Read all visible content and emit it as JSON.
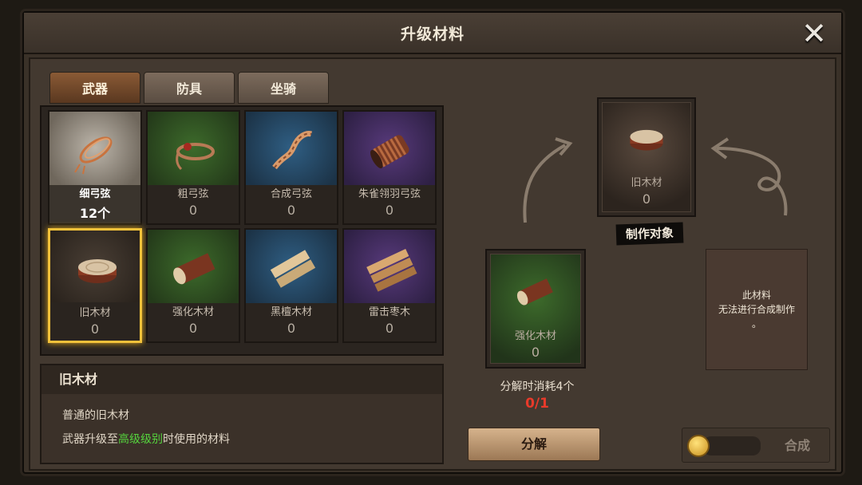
{
  "window": {
    "title": "升级材料",
    "close_icon": "close-icon"
  },
  "tabs": [
    {
      "label": "武器",
      "active": true
    },
    {
      "label": "防具",
      "active": false
    },
    {
      "label": "坐骑",
      "active": false
    }
  ],
  "items": [
    {
      "name": "细弓弦",
      "count": "12个",
      "rarity": "white",
      "icon": "bowstring-coil-icon"
    },
    {
      "name": "粗弓弦",
      "count": "0",
      "rarity": "green",
      "icon": "thick-bowstring-icon"
    },
    {
      "name": "合成弓弦",
      "count": "0",
      "rarity": "blue",
      "icon": "twisted-rope-icon"
    },
    {
      "name": "朱雀翎羽弓弦",
      "count": "0",
      "rarity": "purple",
      "icon": "rope-spool-icon"
    },
    {
      "name": "旧木材",
      "count": "0",
      "rarity": "white",
      "icon": "wood-slice-icon",
      "selected": true
    },
    {
      "name": "强化木材",
      "count": "0",
      "rarity": "green",
      "icon": "log-icon"
    },
    {
      "name": "黑檀木材",
      "count": "0",
      "rarity": "blue",
      "icon": "lumber-planks-icon"
    },
    {
      "name": "雷击枣木",
      "count": "0",
      "rarity": "purple",
      "icon": "lumber-bundle-icon"
    }
  ],
  "description": {
    "title": "旧木材",
    "line1": "普通的旧木材",
    "line2_prefix": "武器升级至",
    "line2_highlight": "高级级别",
    "line2_suffix": "时使用的材料"
  },
  "target": {
    "name": "旧木材",
    "count": "0",
    "label": "制作对象"
  },
  "source": {
    "name": "强化木材",
    "count": "0"
  },
  "consume": {
    "label": "分解时消耗4个",
    "count": "0/1"
  },
  "info": {
    "line1": "此材料",
    "line2": "无法进行合成制作",
    "line3": "。"
  },
  "buttons": {
    "decompose": "分解",
    "craft": "合成"
  },
  "colors": {
    "selected_border": "#f4c23a",
    "highlight_text": "#55d33d",
    "consume_count": "#e83a2a"
  }
}
